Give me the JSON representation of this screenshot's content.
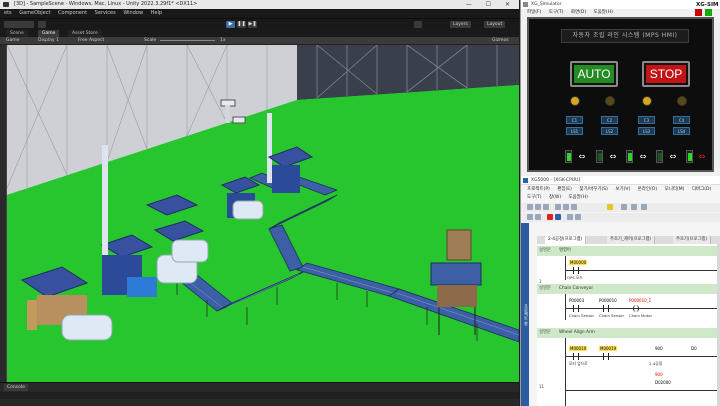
{
  "unity": {
    "title": "[3D] - SampleScene - Windows, Mac, Linux - Unity 2022.3.29f1* <DX11>",
    "menu": [
      "ets",
      "GameObject",
      "Component",
      "Services",
      "Window",
      "Help"
    ],
    "toolbar": {
      "play": "▶",
      "pause": "❚❚",
      "step": "▶❚",
      "layers": "Layers",
      "layout": "Layout"
    },
    "tabs": [
      "Scene",
      "Game",
      "Asset Store"
    ],
    "gamebar": {
      "mode": "Game",
      "display": "Display 1",
      "aspect": "Free Aspect",
      "scale_label": "Scale",
      "scale_value": "1x",
      "gizmos": "Gizmos"
    },
    "console_tab": "Console"
  },
  "xgsim": {
    "title": "XG_Simulator",
    "label": "XG-SIM",
    "menu": [
      "파일(F)",
      "도구(T)",
      "화면(D)",
      "도움말(H)"
    ],
    "banner": "자동차 조립 라인 시스템 (MPS HMI)",
    "auto_label": "AUTO",
    "stop_label": "STOP",
    "small_buttons": [
      "C1",
      "C2",
      "C3",
      "C4",
      "LS1",
      "LS2",
      "LS3",
      "LS4"
    ],
    "colors": {
      "auto": "#228b22",
      "stop": "#c21414",
      "lamp": "#d9a51c"
    }
  },
  "ladder": {
    "title": "XG5000 - [XGK-CPUU]",
    "menu1": [
      "프로젝트(P)",
      "편집(E)",
      "찾기/바꾸기(S)",
      "보기(V)",
      "온라인(O)",
      "모니터(M)",
      "디버그(D)"
    ],
    "menu2": [
      "도구(T)",
      "창(W)",
      "도움말(H)"
    ],
    "side_label": "프로젝트 창",
    "tabs": [
      "2-4공정(프로그램)",
      "주조기_제어(프로그램)",
      "주조기(프로그램)"
    ],
    "sections": [
      {
        "title": "명령어",
        "no": "설명문"
      },
      {
        "title": "Chain Conveyor",
        "no": "설명문"
      },
      {
        "title": "Wheel Align Arm",
        "no": "설명문"
      }
    ],
    "rung1": {
      "contact": "M00000",
      "label": "OPS 모드"
    },
    "rung2": {
      "c1": "P00003",
      "c2": "P000010",
      "c3": "P000010_1",
      "l1": "Chain Sensor",
      "l2": "Chain Sensor",
      "l3": "Chain Motor"
    },
    "rung3": {
      "c1": "M00019",
      "c2": "M00019",
      "v1": "900",
      "v2": "D0",
      "l1": "모터 앞으로",
      "l2": "2-4공정"
    },
    "rung4": {
      "v1": "900",
      "v2": "D02000"
    },
    "row_numbers": [
      "1",
      "11"
    ]
  }
}
